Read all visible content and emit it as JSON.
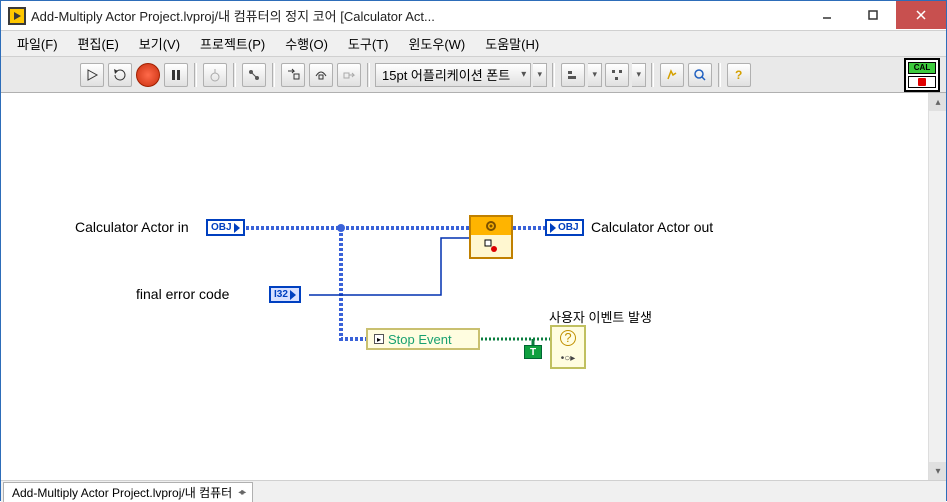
{
  "title": "Add-Multiply Actor Project.lvproj/내 컴퓨터의 정지 코어 [Calculator Act...",
  "menus": [
    "파일(F)",
    "편집(E)",
    "보기(V)",
    "프로젝트(P)",
    "수행(O)",
    "도구(T)",
    "윈도우(W)",
    "도움말(H)"
  ],
  "toolbar": {
    "font_selector": "15pt 어플리케이션 폰트",
    "badge": "CAL"
  },
  "diagram": {
    "actor_in_label": "Calculator Actor in",
    "actor_in_type": "OBJ",
    "actor_out_label": "Calculator Actor out",
    "actor_out_type": "OBJ",
    "error_label": "final error code",
    "error_type": "I32",
    "stop_event_label": "Stop Event",
    "bool_const": "T",
    "user_event_label": "사용자 이벤트 발생"
  },
  "status_tab": "Add-Multiply Actor Project.lvproj/내 컴퓨터"
}
